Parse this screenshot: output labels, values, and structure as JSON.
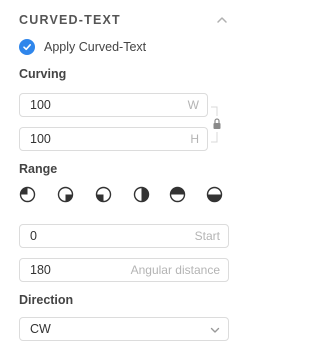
{
  "panel": {
    "title": "CURVED-TEXT",
    "apply_label": "Apply Curved-Text",
    "apply_checked": true
  },
  "curving": {
    "label": "Curving",
    "width_value": "100",
    "width_suffix": "W",
    "height_value": "100",
    "height_suffix": "H"
  },
  "range": {
    "label": "Range",
    "icons": [
      "quarter-circle-icon",
      "three-quarter-circle-icon",
      "half-quarter-circle-icon",
      "left-quarter-circle-icon",
      "half-circle-top-icon",
      "half-circle-bottom-icon"
    ]
  },
  "start": {
    "value": "0",
    "suffix": "Start"
  },
  "angular": {
    "value": "180",
    "suffix": "Angular distance"
  },
  "direction": {
    "label": "Direction",
    "selected": "CW"
  },
  "colors": {
    "accent": "#2f86eb",
    "icon": "#333333",
    "border": "#dcdcdc"
  }
}
